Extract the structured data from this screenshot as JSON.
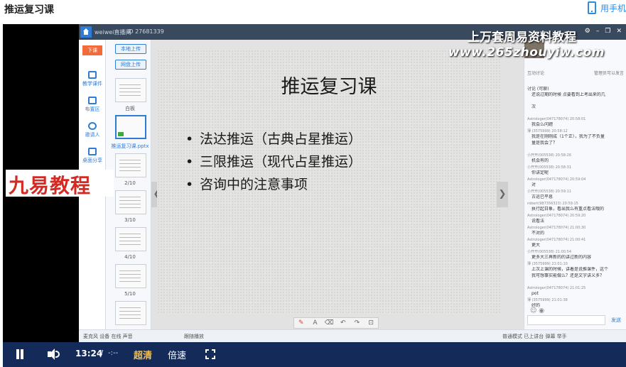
{
  "page": {
    "title": "推运复习课",
    "mobile_link": "用手机"
  },
  "app": {
    "titlebar": {
      "room": "weiwei直播间",
      "id": "ID 27681339"
    },
    "nav": {
      "top_button": "下课",
      "items": [
        "教学课件",
        "布置区",
        "邀请人",
        "桌面分享"
      ]
    },
    "thumbs": {
      "upload_button": "本地上传",
      "cloud_button": "网盘上传",
      "captions": [
        "白板",
        "推运复习课.pptx",
        "2/10",
        "3/10",
        "4/10",
        "5/10"
      ]
    },
    "slide": {
      "title": "推运复习课",
      "bullets": [
        "法达推运（古典占星推运）",
        "三限推运（现代占星推运）",
        "咨询中的注意事项"
      ]
    },
    "chat": {
      "tab_label": "互动讨论",
      "settings_label": "管理员可以发言",
      "subhead": "讨论 (可聊)",
      "messages": [
        {
          "sender": "",
          "text": "还说过期的时候 点要看到上考出来的几"
        },
        {
          "sender": "",
          "text": "次"
        },
        {
          "sender": "Astrologer(047178074) 20:58:01",
          "text": "我会么问题"
        },
        {
          "sender": "薄 (3575999) 20:58:12",
          "text": "我是在刚刚成（1个正），我为了不负量"
        },
        {
          "sender": "",
          "text": "量是我会了？"
        },
        {
          "sender": "小开开(005538) 20:58:26",
          "text": "机会有的"
        },
        {
          "sender": "小开开(005538) 20:58:31",
          "text": "你讲定呢"
        },
        {
          "sender": "Astrologer(047178074) 20:59:04",
          "text": "对"
        },
        {
          "sender": "小开开(005538) 20:59:11",
          "text": "古运已平息"
        },
        {
          "sender": "robert(987356323) 20:59:15",
          "text": "执行起日象，看出我么有重点看法哦的"
        },
        {
          "sender": "Astrologer(047178074) 20:59:20",
          "text": "说看法"
        },
        {
          "sender": "Astrologer(047178074) 21:00:30",
          "text": "不对的"
        },
        {
          "sender": "Astrologer(047178074) 21:00:41",
          "text": "更大"
        },
        {
          "sender": "小开开(005538) 21:00:54",
          "text": "更多大三再新的的讲过新的内容"
        },
        {
          "sender": "薄 (3575999) 21:01:10",
          "text": "上次上课的时候，讲着是说推课件，这个"
        },
        {
          "sender": "",
          "text": "我可想事实能做么？还是文字讲义多？"
        },
        {
          "sender": "Astrologer(047178074) 21:01:25",
          "text": "pot"
        },
        {
          "sender": "薄 (3575999) 21:01:38",
          "text": "好的"
        }
      ],
      "send_label": "发送"
    },
    "statusbar": {
      "left": "麦克风  设备  在线  声音",
      "follow": "跟随播放",
      "right": "普通模式  已上讲台  弹幕  举手"
    }
  },
  "watermark": {
    "top_text": "上万套周易资料教程",
    "url": "www.265zhouyiw.com",
    "banner": "九易教程"
  },
  "player": {
    "current_time": "13:24",
    "separator": "/",
    "total_time": "-:--",
    "quality": "超清",
    "speed": "倍速"
  }
}
